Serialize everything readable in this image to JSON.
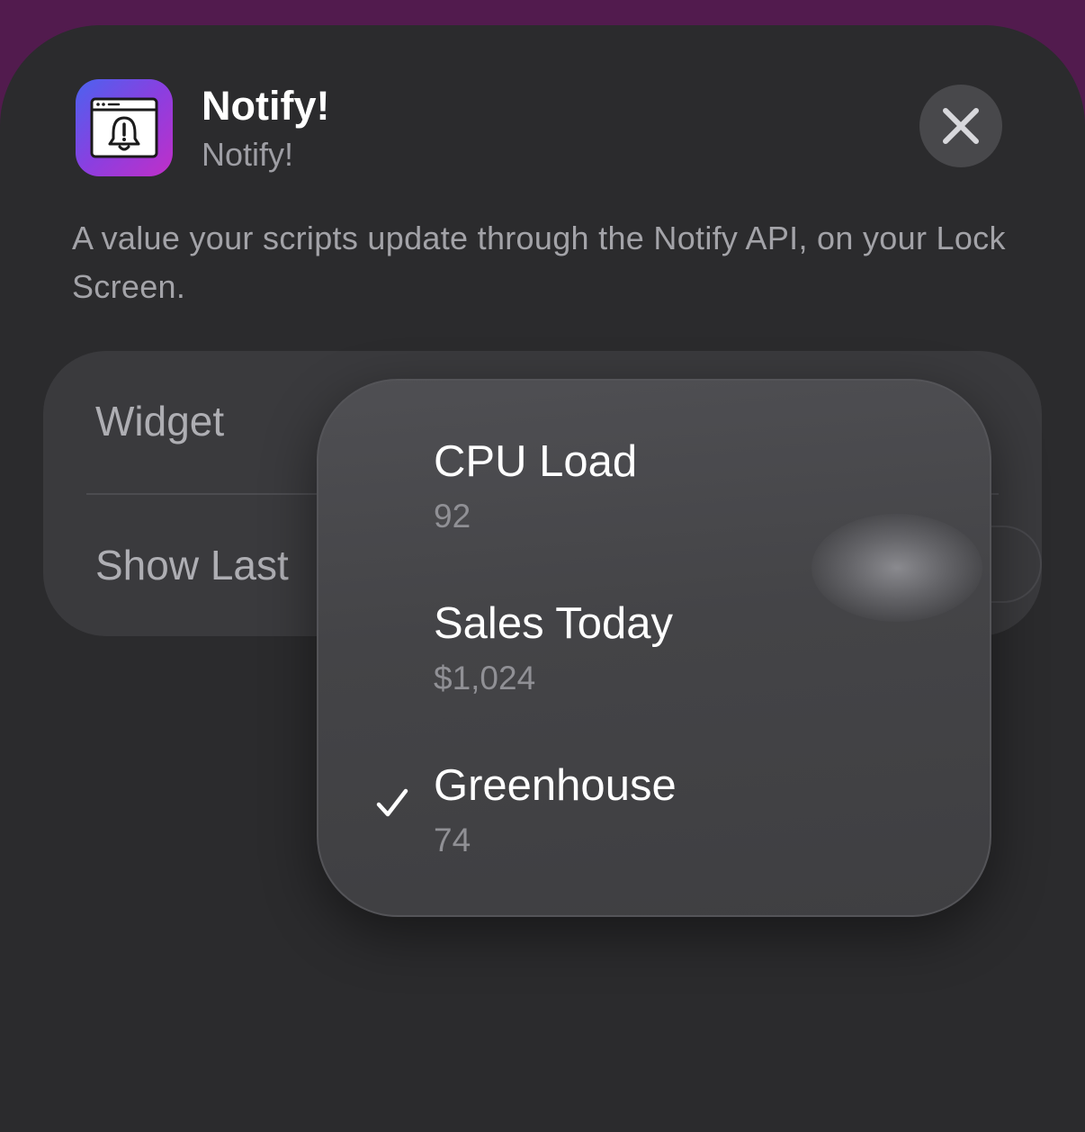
{
  "header": {
    "app_name": "Notify!",
    "app_subtitle": "Notify!",
    "app_icon": "browser-window-bell-icon",
    "close_icon": "xmark-icon"
  },
  "description": "A value your scripts update through the Notify API, on your Lock Screen.",
  "config": {
    "rows": [
      {
        "label": "Widget"
      },
      {
        "label": "Show Last"
      }
    ]
  },
  "menu": {
    "items": [
      {
        "title": "CPU Load",
        "value": "92",
        "selected": false
      },
      {
        "title": "Sales Today",
        "value": "$1,024",
        "selected": false
      },
      {
        "title": "Greenhouse",
        "value": "74",
        "selected": true
      }
    ]
  },
  "colors": {
    "background_top": "#521b4e",
    "sheet": "#2b2b2d",
    "card": "#3a3a3d",
    "menu": "#48484b",
    "icon_gradient_start": "#4b63ef",
    "icon_gradient_end": "#c02fc8"
  }
}
